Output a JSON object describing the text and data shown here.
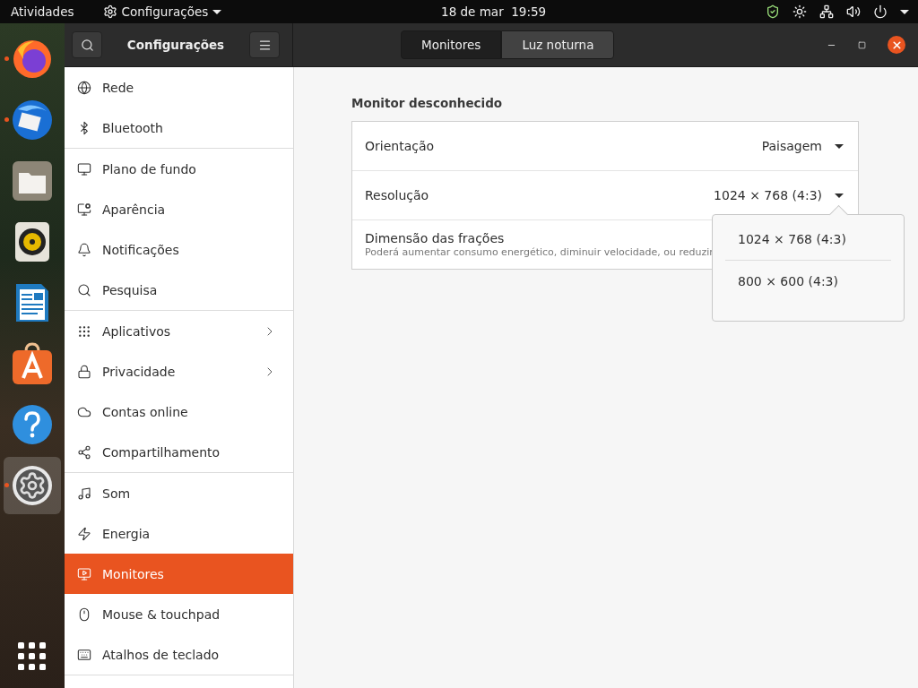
{
  "top_bar": {
    "activities": "Atividades",
    "app_menu": "Configurações",
    "clock": "18 de mar  19:59"
  },
  "dock": [
    {
      "kind": "browser",
      "running": true,
      "selected": false
    },
    {
      "kind": "mail",
      "running": true,
      "selected": false
    },
    {
      "kind": "folder",
      "running": false,
      "selected": false
    },
    {
      "kind": "speaker",
      "running": false,
      "selected": false
    },
    {
      "kind": "document",
      "running": false,
      "selected": false
    },
    {
      "kind": "store",
      "running": false,
      "selected": false
    },
    {
      "kind": "help",
      "running": false,
      "selected": false
    },
    {
      "kind": "gear",
      "running": true,
      "selected": true
    }
  ],
  "header": {
    "title": "Configurações",
    "tabs": [
      {
        "label": "Monitores",
        "selected": true
      },
      {
        "label": "Luz noturna",
        "selected": false
      }
    ]
  },
  "sidebar": {
    "groups": [
      {
        "items": [
          {
            "label": "Rede",
            "has_submenu": false,
            "selected": false
          },
          {
            "label": "Bluetooth",
            "has_submenu": false,
            "selected": false
          }
        ]
      },
      {
        "items": [
          {
            "label": "Plano de fundo",
            "has_submenu": false,
            "selected": false
          },
          {
            "label": "Aparência",
            "has_submenu": false,
            "selected": false
          },
          {
            "label": "Notificações",
            "has_submenu": false,
            "selected": false
          },
          {
            "label": "Pesquisa",
            "has_submenu": false,
            "selected": false
          }
        ]
      },
      {
        "items": [
          {
            "label": "Aplicativos",
            "has_submenu": true,
            "selected": false
          },
          {
            "label": "Privacidade",
            "has_submenu": true,
            "selected": false
          },
          {
            "label": "Contas online",
            "has_submenu": false,
            "selected": false
          },
          {
            "label": "Compartilhamento",
            "has_submenu": false,
            "selected": false
          }
        ]
      },
      {
        "items": [
          {
            "label": "Som",
            "has_submenu": false,
            "selected": false
          },
          {
            "label": "Energia",
            "has_submenu": false,
            "selected": false
          },
          {
            "label": "Monitores",
            "has_submenu": false,
            "selected": true
          },
          {
            "label": "Mouse & touchpad",
            "has_submenu": false,
            "selected": false
          },
          {
            "label": "Atalhos de teclado",
            "has_submenu": false,
            "selected": false
          }
        ]
      }
    ]
  },
  "monitor": {
    "title": "Monitor desconhecido",
    "rows": [
      {
        "label": "Orientação",
        "value": "Paisagem"
      },
      {
        "label": "Resolução",
        "value": "1024 × 768 (4:3)"
      },
      {
        "label": "Dimensão das frações",
        "description": "Poderá aumentar consumo energético, diminuir velocidade, ou reduzir"
      }
    ]
  },
  "resolution_popover": {
    "options": [
      {
        "label": "1024 × 768 (4:3)"
      },
      {
        "label": "800 × 600 (4:3)"
      }
    ]
  }
}
